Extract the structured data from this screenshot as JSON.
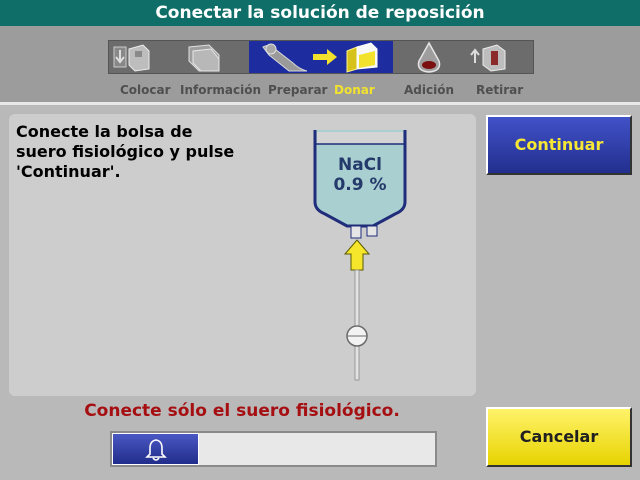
{
  "header": {
    "title": "Conectar la solución de reposición"
  },
  "steps": [
    {
      "label": "Colocar",
      "icon": "kit-load-icon"
    },
    {
      "label": "Información",
      "icon": "folder-icon"
    },
    {
      "label": "Preparar",
      "icon": "patient-icon"
    },
    {
      "label": "Donar",
      "icon": "donate-icon",
      "current": true
    },
    {
      "label": "Adición",
      "icon": "flask-icon"
    },
    {
      "label": "Retirar",
      "icon": "kit-unload-icon"
    }
  ],
  "instruction": "Conecte la bolsa de\nsuero fisiológico y pulse\n'Continuar'.",
  "bag": {
    "line1": "NaCl",
    "line2": "0.9 %"
  },
  "buttons": {
    "continue": "Continuar",
    "cancel": "Cancelar"
  },
  "warning": "Conecte sólo el suero fisiológico.",
  "progress": {
    "fraction": 0.27,
    "icon": "bell-icon"
  },
  "colors": {
    "title_bar": "#0f6e68",
    "active_step": "#1d2c9e",
    "current_label": "#f2e22e",
    "warning": "#a60f12",
    "continue_text": "#f6e735",
    "cancel_bg": "#f2e21a"
  }
}
